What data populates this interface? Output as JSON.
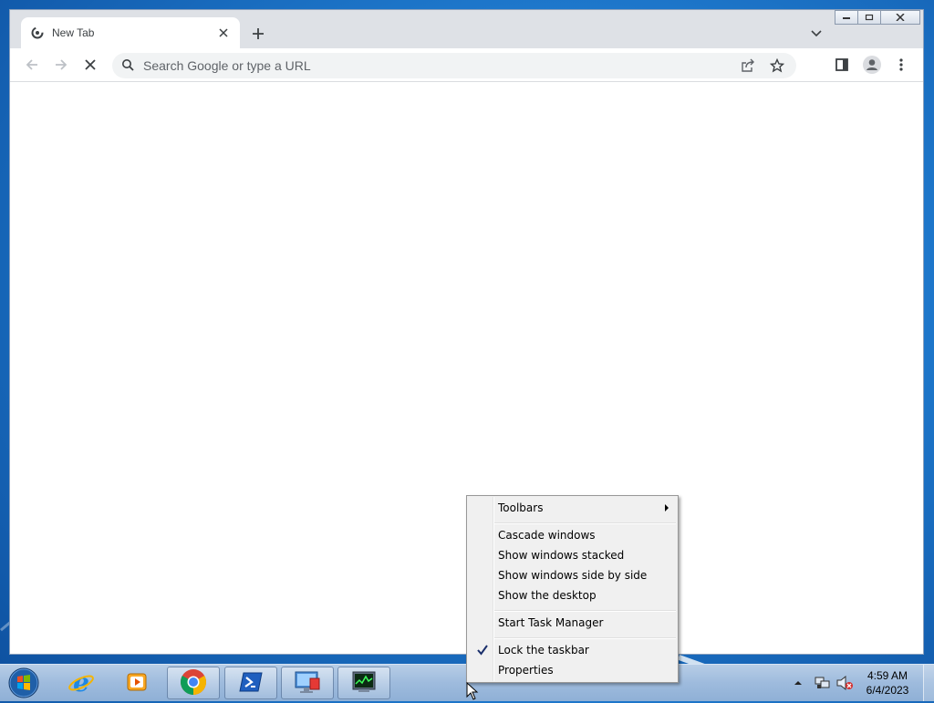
{
  "browser": {
    "tab_title": "New Tab",
    "omnibox_placeholder": "Search Google or type a URL"
  },
  "context_menu": {
    "items": [
      {
        "label": "Toolbars",
        "submenu": true
      },
      {
        "label": "Cascade windows"
      },
      {
        "label": "Show windows stacked"
      },
      {
        "label": "Show windows side by side"
      },
      {
        "label": "Show the desktop"
      },
      {
        "label": "Start Task Manager"
      },
      {
        "label": "Lock the taskbar",
        "checked": true
      },
      {
        "label": "Properties"
      }
    ]
  },
  "taskbar": {
    "pinned": [
      "internet-explorer",
      "media-player",
      "chrome",
      "powershell",
      "remote-desktop",
      "task-manager"
    ],
    "clock": {
      "time": "4:59 AM",
      "date": "6/4/2023"
    }
  },
  "colors": {
    "accent": "#1a73e8",
    "desktop": "#1e78cc"
  }
}
